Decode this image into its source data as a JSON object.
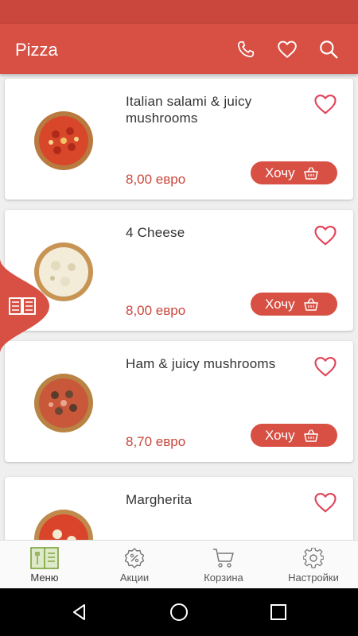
{
  "app_bar": {
    "title": "Pizza"
  },
  "products": [
    {
      "title": " Italian salami & juicy mushrooms",
      "price": "8,00 евро",
      "button": "Хочу"
    },
    {
      "title": "4 Cheese",
      "price": "8,00 евро",
      "button": "Хочу"
    },
    {
      "title": "Ham & juicy mushrooms",
      "price": "8,70 евро",
      "button": "Хочу"
    },
    {
      "title": "Margherita"
    }
  ],
  "bottom_nav": [
    {
      "label": "Меню",
      "icon": "menu-book-icon",
      "active": true
    },
    {
      "label": "Акции",
      "icon": "discount-icon"
    },
    {
      "label": "Корзина",
      "icon": "cart-icon"
    },
    {
      "label": "Настройки",
      "icon": "gear-icon"
    }
  ],
  "colors": {
    "primary": "#d84f43",
    "status": "#c9473c",
    "price": "#c9473c",
    "active_nav": "#7aa23a"
  }
}
